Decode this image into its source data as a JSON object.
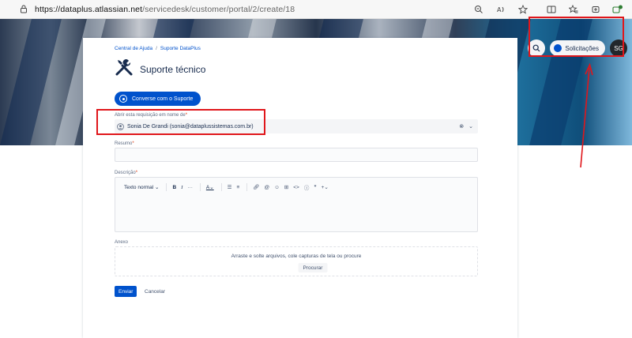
{
  "browser": {
    "url_host": "https://dataplus.atlassian.net",
    "url_path": "/servicedesk/customer/portal/2/create/18",
    "icons": [
      "lock-icon",
      "zoom-icon",
      "read-aloud-icon",
      "favorite-star-icon",
      "split-screen-icon",
      "favorites-icon",
      "collections-icon",
      "extensions-icon"
    ]
  },
  "header": {
    "requests_label": "Solicitações",
    "avatar_initials": "SG"
  },
  "breadcrumb": {
    "home": "Central de Ajuda",
    "separator": "/",
    "portal": "Suporte DataPlus"
  },
  "page": {
    "title": "Suporte técnico",
    "chat_button": "Converse com o Suporte"
  },
  "form": {
    "on_behalf_label": "Abrir esta requisição em nome de",
    "on_behalf_value": "Sonia De Grandi (sonia@dataplussistemas.com.br)",
    "summary_label": "Resumo",
    "description_label": "Descrição",
    "required_mark": "*",
    "editor": {
      "text_style": "Texto normal",
      "bold": "B",
      "italic": "I",
      "more": "···"
    },
    "attachment_label": "Anexo",
    "attachment_hint": "Arraste e solte arquivos, cole capturas de tela ou procure",
    "browse_button": "Procurar",
    "submit_button": "Enviar",
    "cancel_button": "Cancelar"
  },
  "colors": {
    "primary": "#0052cc",
    "annotation": "#e0161b"
  }
}
